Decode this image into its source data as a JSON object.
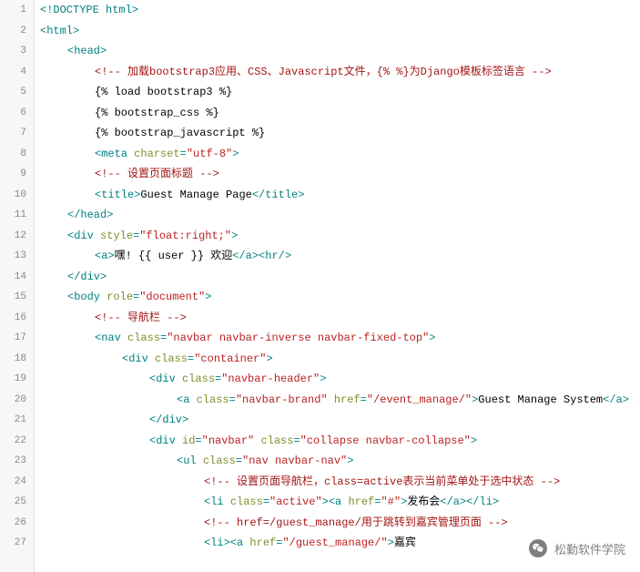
{
  "lines": [
    {
      "n": 1,
      "indent": 0,
      "segs": [
        {
          "c": "tag",
          "t": "<!DOCTYPE html>"
        }
      ]
    },
    {
      "n": 2,
      "indent": 0,
      "segs": [
        {
          "c": "tag",
          "t": "<html>"
        }
      ]
    },
    {
      "n": 3,
      "indent": 1,
      "segs": [
        {
          "c": "tag",
          "t": "<head>"
        }
      ]
    },
    {
      "n": 4,
      "indent": 2,
      "segs": [
        {
          "c": "cmt",
          "t": "<!-- 加载bootstrap3应用、CSS、Javascript文件，{% %}为Django模板标签语言 -->"
        }
      ]
    },
    {
      "n": 5,
      "indent": 2,
      "segs": [
        {
          "c": "tpl",
          "t": "{% load bootstrap3 %}"
        }
      ]
    },
    {
      "n": 6,
      "indent": 2,
      "segs": [
        {
          "c": "tpl",
          "t": "{% bootstrap_css %}"
        }
      ]
    },
    {
      "n": 7,
      "indent": 2,
      "segs": [
        {
          "c": "tpl",
          "t": "{% bootstrap_javascript %}"
        }
      ]
    },
    {
      "n": 8,
      "indent": 2,
      "segs": [
        {
          "c": "tag",
          "t": "<meta "
        },
        {
          "c": "attr-n",
          "t": "charset"
        },
        {
          "c": "tag",
          "t": "="
        },
        {
          "c": "attr-v",
          "t": "\"utf-8\""
        },
        {
          "c": "tag",
          "t": ">"
        }
      ]
    },
    {
      "n": 9,
      "indent": 2,
      "segs": [
        {
          "c": "cmt",
          "t": "<!-- 设置页面标题 -->"
        }
      ]
    },
    {
      "n": 10,
      "indent": 2,
      "segs": [
        {
          "c": "tag",
          "t": "<title>"
        },
        {
          "c": "txt",
          "t": "Guest Manage Page"
        },
        {
          "c": "tag",
          "t": "</title>"
        }
      ]
    },
    {
      "n": 11,
      "indent": 1,
      "segs": [
        {
          "c": "tag",
          "t": "</head>"
        }
      ]
    },
    {
      "n": 12,
      "indent": 1,
      "segs": [
        {
          "c": "tag",
          "t": "<div "
        },
        {
          "c": "attr-n",
          "t": "style"
        },
        {
          "c": "tag",
          "t": "="
        },
        {
          "c": "attr-v",
          "t": "\"float:right;\""
        },
        {
          "c": "tag",
          "t": ">"
        }
      ]
    },
    {
      "n": 13,
      "indent": 2,
      "segs": [
        {
          "c": "tag",
          "t": "<a>"
        },
        {
          "c": "txt",
          "t": "嘿! {{ user }} 欢迎"
        },
        {
          "c": "tag",
          "t": "</a><hr/>"
        }
      ]
    },
    {
      "n": 14,
      "indent": 1,
      "segs": [
        {
          "c": "tag",
          "t": "</div>"
        }
      ]
    },
    {
      "n": 15,
      "indent": 1,
      "segs": [
        {
          "c": "tag",
          "t": "<body "
        },
        {
          "c": "attr-n",
          "t": "role"
        },
        {
          "c": "tag",
          "t": "="
        },
        {
          "c": "attr-v",
          "t": "\"document\""
        },
        {
          "c": "tag",
          "t": ">"
        }
      ]
    },
    {
      "n": 16,
      "indent": 2,
      "segs": [
        {
          "c": "cmt",
          "t": "<!-- 导航栏 -->"
        }
      ]
    },
    {
      "n": 17,
      "indent": 2,
      "segs": [
        {
          "c": "tag",
          "t": "<nav "
        },
        {
          "c": "attr-n",
          "t": "class"
        },
        {
          "c": "tag",
          "t": "="
        },
        {
          "c": "attr-v",
          "t": "\"navbar navbar-inverse navbar-fixed-top\""
        },
        {
          "c": "tag",
          "t": ">"
        }
      ]
    },
    {
      "n": 18,
      "indent": 3,
      "segs": [
        {
          "c": "tag",
          "t": "<div "
        },
        {
          "c": "attr-n",
          "t": "class"
        },
        {
          "c": "tag",
          "t": "="
        },
        {
          "c": "attr-v",
          "t": "\"container\""
        },
        {
          "c": "tag",
          "t": ">"
        }
      ]
    },
    {
      "n": 19,
      "indent": 4,
      "segs": [
        {
          "c": "tag",
          "t": "<div "
        },
        {
          "c": "attr-n",
          "t": "class"
        },
        {
          "c": "tag",
          "t": "="
        },
        {
          "c": "attr-v",
          "t": "\"navbar-header\""
        },
        {
          "c": "tag",
          "t": ">"
        }
      ]
    },
    {
      "n": 20,
      "indent": 5,
      "segs": [
        {
          "c": "tag",
          "t": "<a "
        },
        {
          "c": "attr-n",
          "t": "class"
        },
        {
          "c": "tag",
          "t": "="
        },
        {
          "c": "attr-v",
          "t": "\"navbar-brand\""
        },
        {
          "c": "tag",
          "t": " "
        },
        {
          "c": "attr-n",
          "t": "href"
        },
        {
          "c": "tag",
          "t": "="
        },
        {
          "c": "attr-v",
          "t": "\"/event_manage/\""
        },
        {
          "c": "tag",
          "t": ">"
        },
        {
          "c": "txt",
          "t": "Guest Manage System"
        },
        {
          "c": "tag",
          "t": "</a>"
        }
      ]
    },
    {
      "n": 21,
      "indent": 4,
      "segs": [
        {
          "c": "tag",
          "t": "</div>"
        }
      ]
    },
    {
      "n": 22,
      "indent": 4,
      "segs": [
        {
          "c": "tag",
          "t": "<div "
        },
        {
          "c": "attr-n",
          "t": "id"
        },
        {
          "c": "tag",
          "t": "="
        },
        {
          "c": "attr-v",
          "t": "\"navbar\""
        },
        {
          "c": "tag",
          "t": " "
        },
        {
          "c": "attr-n",
          "t": "class"
        },
        {
          "c": "tag",
          "t": "="
        },
        {
          "c": "attr-v",
          "t": "\"collapse navbar-collapse\""
        },
        {
          "c": "tag",
          "t": ">"
        }
      ]
    },
    {
      "n": 23,
      "indent": 5,
      "segs": [
        {
          "c": "tag",
          "t": "<ul "
        },
        {
          "c": "attr-n",
          "t": "class"
        },
        {
          "c": "tag",
          "t": "="
        },
        {
          "c": "attr-v",
          "t": "\"nav navbar-nav\""
        },
        {
          "c": "tag",
          "t": ">"
        }
      ]
    },
    {
      "n": 24,
      "indent": 6,
      "segs": [
        {
          "c": "cmt",
          "t": "<!-- 设置页面导航栏，class=active表示当前菜单处于选中状态 -->"
        }
      ]
    },
    {
      "n": 25,
      "indent": 6,
      "segs": [
        {
          "c": "tag",
          "t": "<li "
        },
        {
          "c": "attr-n",
          "t": "class"
        },
        {
          "c": "tag",
          "t": "="
        },
        {
          "c": "attr-v",
          "t": "\"active\""
        },
        {
          "c": "tag",
          "t": "><a "
        },
        {
          "c": "attr-n",
          "t": "href"
        },
        {
          "c": "tag",
          "t": "="
        },
        {
          "c": "attr-v",
          "t": "\"#\""
        },
        {
          "c": "tag",
          "t": ">"
        },
        {
          "c": "txt",
          "t": "发布会"
        },
        {
          "c": "tag",
          "t": "</a></li>"
        }
      ]
    },
    {
      "n": 26,
      "indent": 6,
      "segs": [
        {
          "c": "cmt",
          "t": "<!-- href=/guest_manage/用于跳转到嘉宾管理页面 -->"
        }
      ]
    },
    {
      "n": 27,
      "indent": 6,
      "segs": [
        {
          "c": "tag",
          "t": "<li><a "
        },
        {
          "c": "attr-n",
          "t": "href"
        },
        {
          "c": "tag",
          "t": "="
        },
        {
          "c": "attr-v",
          "t": "\"/guest_manage/\""
        },
        {
          "c": "tag",
          "t": ">"
        },
        {
          "c": "txt",
          "t": "嘉宾"
        }
      ]
    }
  ],
  "watermark": {
    "text": "松勤软件学院"
  }
}
